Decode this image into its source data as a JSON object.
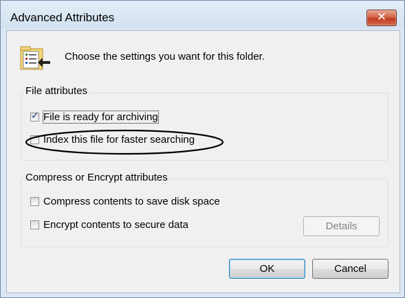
{
  "window": {
    "title": "Advanced Attributes",
    "close_glyph": "✕"
  },
  "header": {
    "icon": "folder-properties-icon",
    "text": "Choose the settings you want for this folder."
  },
  "file_attributes": {
    "label": "File attributes",
    "items": [
      {
        "label": "File is ready for archiving",
        "checked": true
      },
      {
        "label": "Index this file for faster searching",
        "checked": false
      }
    ]
  },
  "compress_encrypt": {
    "label": "Compress or Encrypt attributes",
    "items": [
      {
        "label": "Compress contents to save disk space",
        "checked": false
      },
      {
        "label": "Encrypt contents to secure data",
        "checked": false
      }
    ],
    "details_button": "Details"
  },
  "buttons": {
    "ok": "OK",
    "cancel": "Cancel"
  },
  "colors": {
    "close_button": "#c8442a",
    "annotation_ellipse": "#000000",
    "client_bg": "#f0f0f0"
  }
}
